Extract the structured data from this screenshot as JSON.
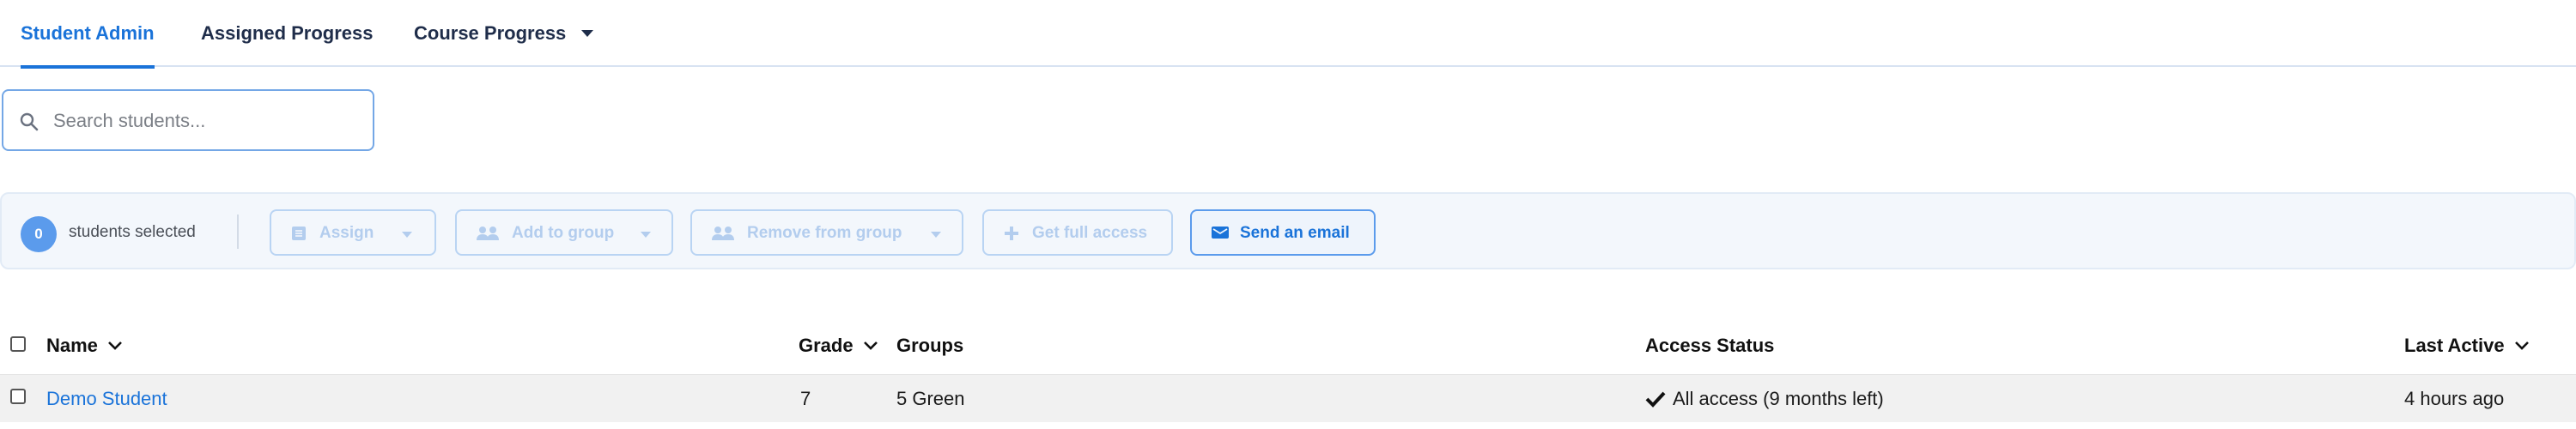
{
  "tabs": [
    {
      "label": "Student Admin",
      "active": true
    },
    {
      "label": "Assigned Progress",
      "active": false
    },
    {
      "label": "Course Progress",
      "active": false
    }
  ],
  "search": {
    "placeholder": "Search students..."
  },
  "bulk": {
    "count": "0",
    "count_label": "students selected",
    "assign": "Assign",
    "add_to_group": "Add to group",
    "remove_from_group": "Remove from group",
    "get_full_access": "Get full access",
    "send_email": "Send an email"
  },
  "table": {
    "columns": {
      "name": "Name",
      "grade": "Grade",
      "groups": "Groups",
      "access_status": "Access Status",
      "last_active": "Last Active"
    },
    "rows": [
      {
        "name": "Demo Student",
        "grade": "7",
        "groups": "5 Green",
        "access_status": "All access (9 months left)",
        "last_active": "4 hours ago"
      }
    ]
  },
  "colors": {
    "accent": "#1a73d9",
    "disabled": "#b3cdee",
    "bar_bg": "#f3f7fc",
    "row_bg": "#f1f1f1"
  },
  "icons": [
    "search-icon",
    "list-icon",
    "people-icon",
    "plus-icon",
    "envelope-icon",
    "chevron-down-icon",
    "checkmark-icon"
  ]
}
